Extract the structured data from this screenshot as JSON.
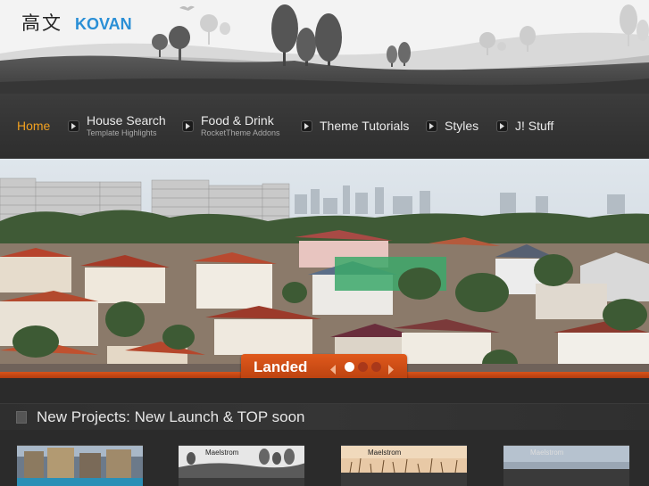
{
  "header": {
    "logo_cn": "高文",
    "logo_en": "KOVAN"
  },
  "nav": {
    "items": [
      {
        "label": "Home",
        "sub": "",
        "active": true
      },
      {
        "label": "House Search",
        "sub": "Template Highlights"
      },
      {
        "label": "Food & Drink",
        "sub": "RocketTheme Addons"
      },
      {
        "label": "Theme Tutorials",
        "sub": ""
      },
      {
        "label": "Styles",
        "sub": ""
      },
      {
        "label": "J! Stuff",
        "sub": ""
      }
    ]
  },
  "slider": {
    "title": "Landed",
    "dots": 3,
    "active_dot": 1
  },
  "section": {
    "title": "New Projects: New Launch & TOP soon"
  },
  "thumbnails": [
    {
      "label": ""
    },
    {
      "label": "Maelstrom"
    },
    {
      "label": "Maelstrom"
    },
    {
      "label": "Maelstrom"
    }
  ],
  "colors": {
    "accent": "#f0a020",
    "logo_blue": "#2a8fd6",
    "slider_orange": "#d8541a"
  }
}
